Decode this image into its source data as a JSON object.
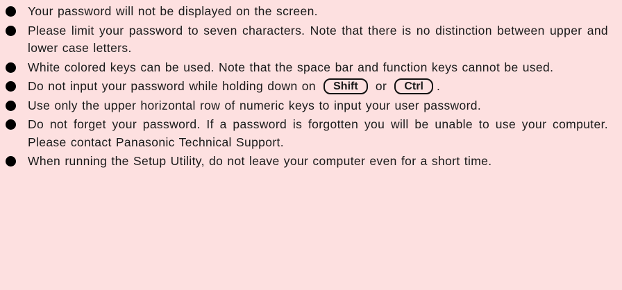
{
  "notes": {
    "item1": "Your password will not be displayed on the screen.",
    "item2": "Please limit your password to seven characters.  Note that there is no distinction between upper and lower case letters.",
    "item3": "White colored keys can be used.  Note that the space bar and function keys cannot be used.",
    "item4": {
      "before": "Do not input your password while holding down on",
      "key1": "Shift",
      "between": "or",
      "key2": "Ctrl",
      "after": "."
    },
    "item5": "Use only the upper horizontal row of numeric keys to input your user password.",
    "item6": "Do not forget your password.  If a password is forgotten you will be unable to use your computer.  Please contact Panasonic Technical Support.",
    "item7": "When running the Setup Utility, do not leave your computer even for a short time."
  }
}
